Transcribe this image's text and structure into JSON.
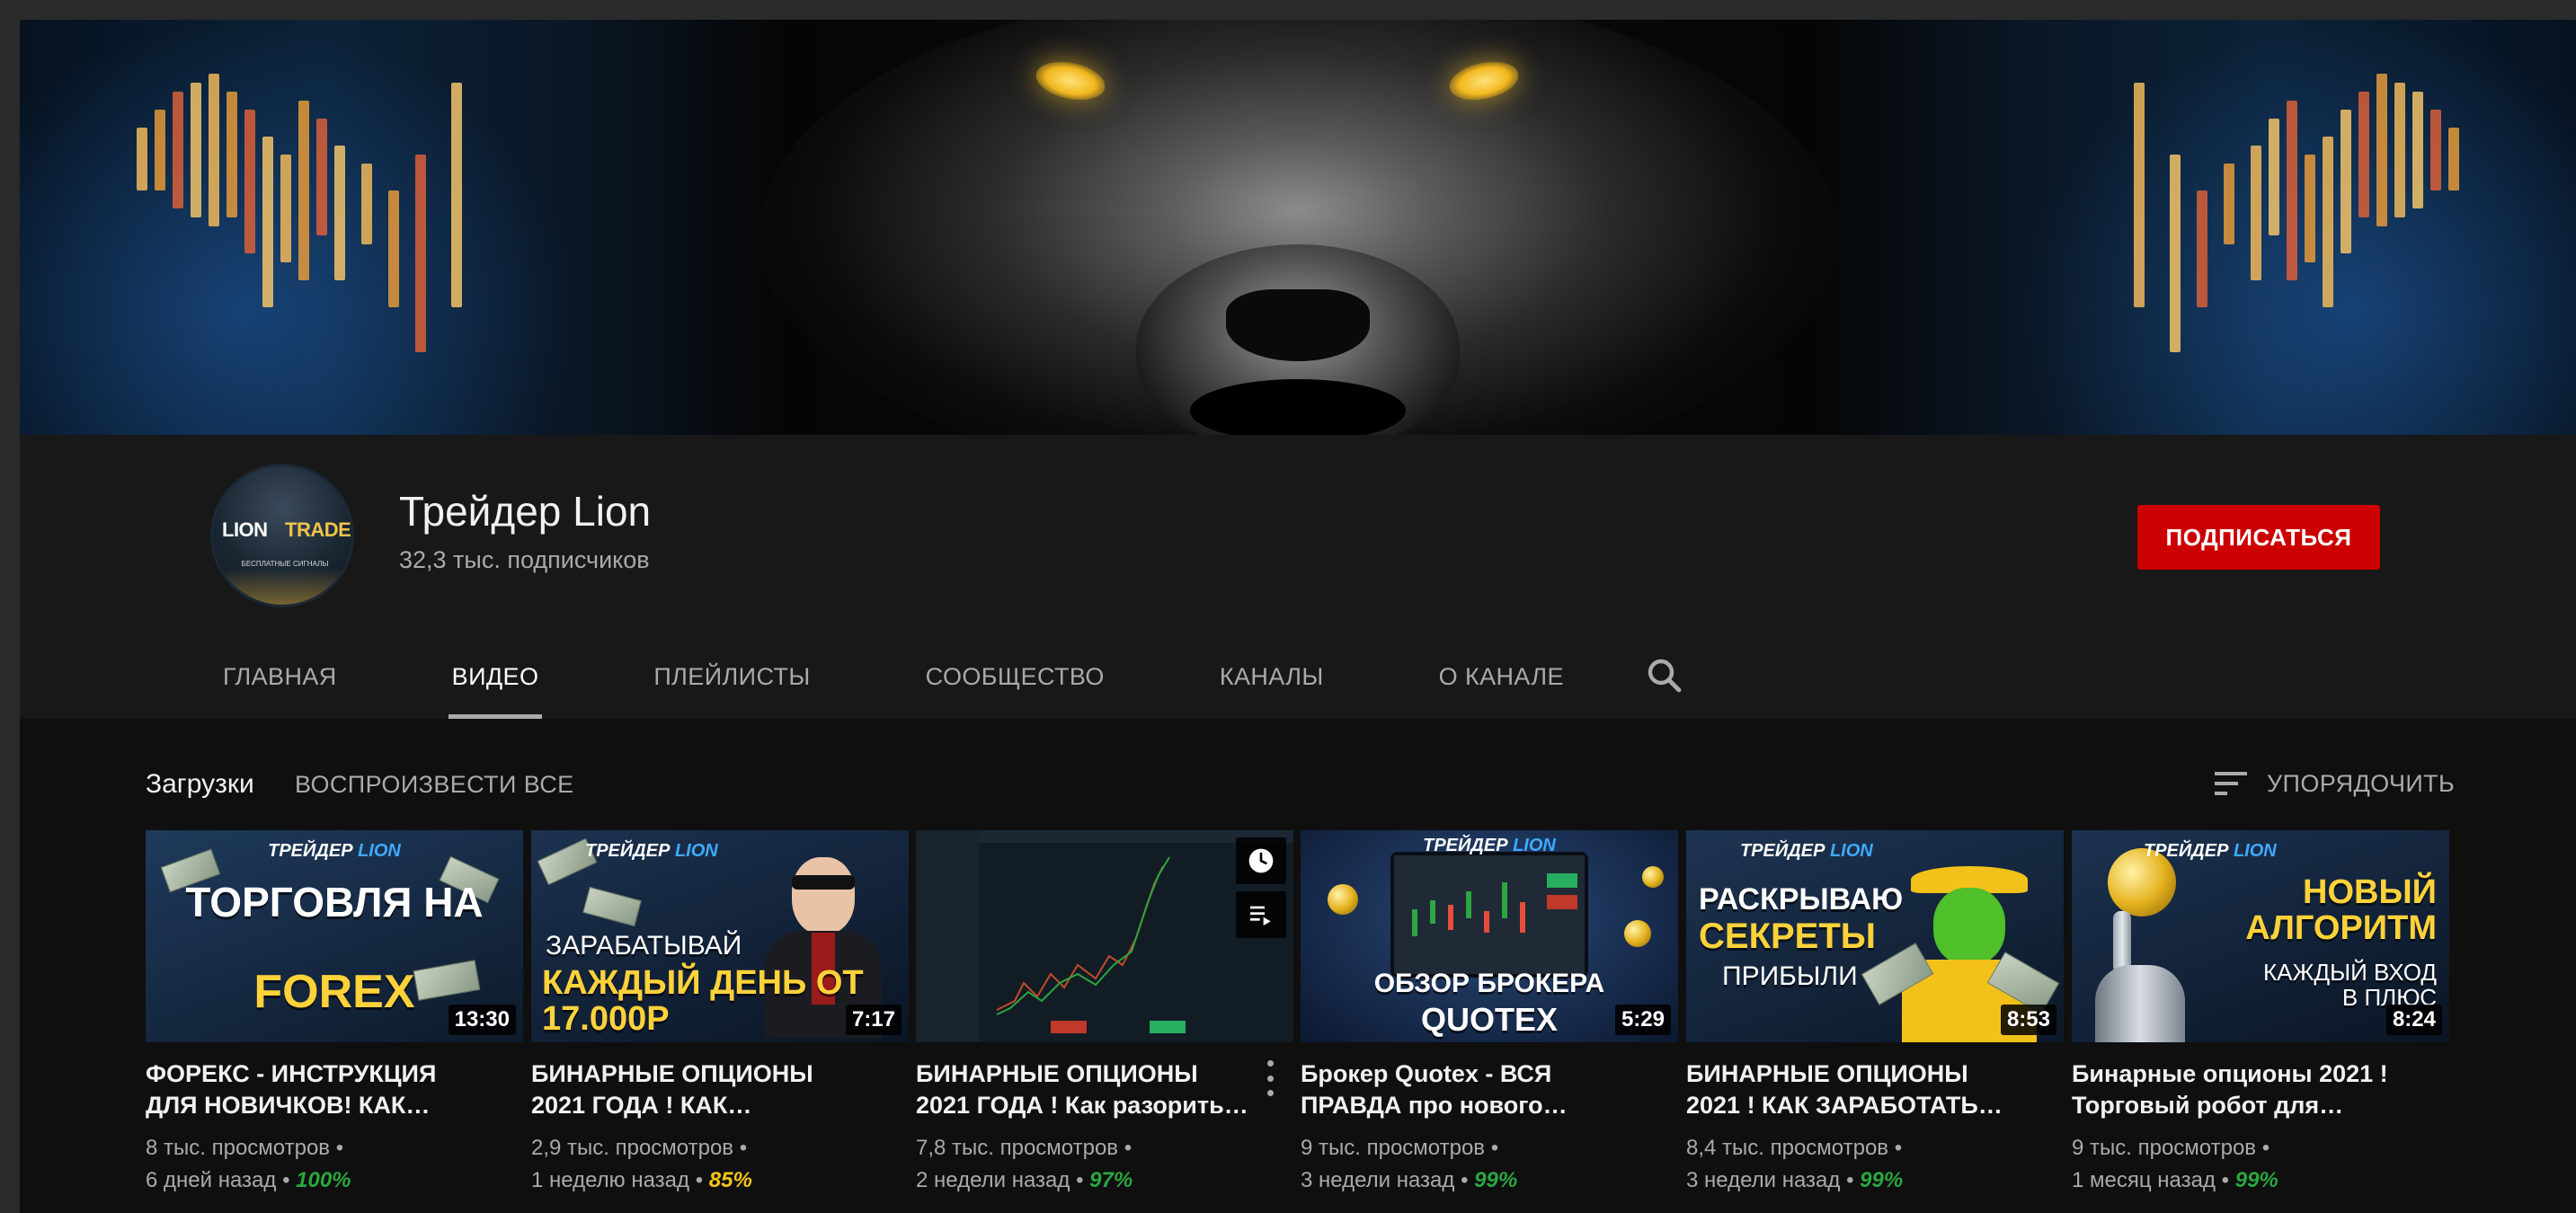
{
  "channel": {
    "name": "Трейдер Lion",
    "subscribers": "32,3 тыс. подписчиков",
    "subscribe_label": "ПОДПИСАТЬСЯ",
    "avatar_logo_part1": "LION",
    "avatar_logo_part2": "TRADER",
    "avatar_tagline": "БЕСПЛАТНЫЕ СИГНАЛЫ"
  },
  "tabs": [
    {
      "label": "ГЛАВНАЯ"
    },
    {
      "label": "ВИДЕО"
    },
    {
      "label": "ПЛЕЙЛИСТЫ"
    },
    {
      "label": "СООБЩЕСТВО"
    },
    {
      "label": "КАНАЛЫ"
    },
    {
      "label": "О КАНАЛЕ"
    }
  ],
  "active_tab": "ВИДЕО",
  "section": {
    "title": "Загрузки",
    "play_all": "ВОСПРОИЗВЕСТИ ВСЕ",
    "sort_label": "УПОРЯДОЧИТЬ"
  },
  "colors": {
    "subscribe": "#cc0000",
    "pct_green": "#2ba640",
    "pct_yellow": "#f5c518",
    "brand_blue": "#3fa9ff",
    "thumb_yellow": "#ffd23a"
  },
  "thumb_brand": {
    "part1": "ТРЕЙДЕР",
    "part2": "LION"
  },
  "videos": [
    {
      "thumb_line1": "ТОРГОВЛЯ НА",
      "thumb_line2": "FOREX",
      "duration": "13:30",
      "title": "ФОРЕКС - ИНСТРУКЦИЯ ДЛЯ НОВИЧКОВ! КАК…",
      "views": "8 тыс. просмотров",
      "age": "6 дней назад",
      "rating": "100%",
      "rating_color": "green"
    },
    {
      "thumb_line1": "ЗАРАБАТЫВАЙ",
      "thumb_line2": "КАЖДЫЙ ДЕНЬ ОТ 17.000Р",
      "duration": "7:17",
      "title": "БИНАРНЫЕ ОПЦИОНЫ 2021 ГОДА ! КАК…",
      "views": "2,9 тыс. просмотров",
      "age": "1 неделю назад",
      "rating": "85%",
      "rating_color": "yellow"
    },
    {
      "duration": "",
      "title": "БИНАРНЫЕ ОПЦИОНЫ 2021 ГОДА ! Как разорить…",
      "views": "7,8 тыс. просмотров",
      "age": "2 недели назад",
      "rating": "97%",
      "rating_color": "green",
      "hover_icons": [
        "clock-icon",
        "add-to-queue-icon"
      ]
    },
    {
      "thumb_line1": "ОБЗОР БРОКЕРА",
      "thumb_line2": "QUOTEX",
      "duration": "5:29",
      "title": "Брокер Quotex - ВСЯ ПРАВДА про нового…",
      "views": "9 тыс. просмотров",
      "age": "3 недели назад",
      "rating": "99%",
      "rating_color": "green"
    },
    {
      "thumb_line1": "РАСКРЫВАЮ",
      "thumb_line2": "СЕКРЕТЫ",
      "thumb_line3": "ПРИБЫЛИ",
      "duration": "8:53",
      "title": "БИНАРНЫЕ ОПЦИОНЫ 2021 ! КАК ЗАРАБОТАТЬ…",
      "views": "8,4 тыс. просмотров",
      "age": "3 недели назад",
      "rating": "99%",
      "rating_color": "green"
    },
    {
      "thumb_line1": "НОВЫЙ",
      "thumb_line2": "АЛГОРИТМ",
      "thumb_line3": "КАЖДЫЙ ВХОД В ПЛЮС",
      "duration": "8:24",
      "title": "Бинарные опционы 2021 ! Торговый робот для…",
      "views": "9 тыс. просмотров",
      "age": "1 месяц назад",
      "rating": "99%",
      "rating_color": "green"
    }
  ],
  "separator": "•"
}
